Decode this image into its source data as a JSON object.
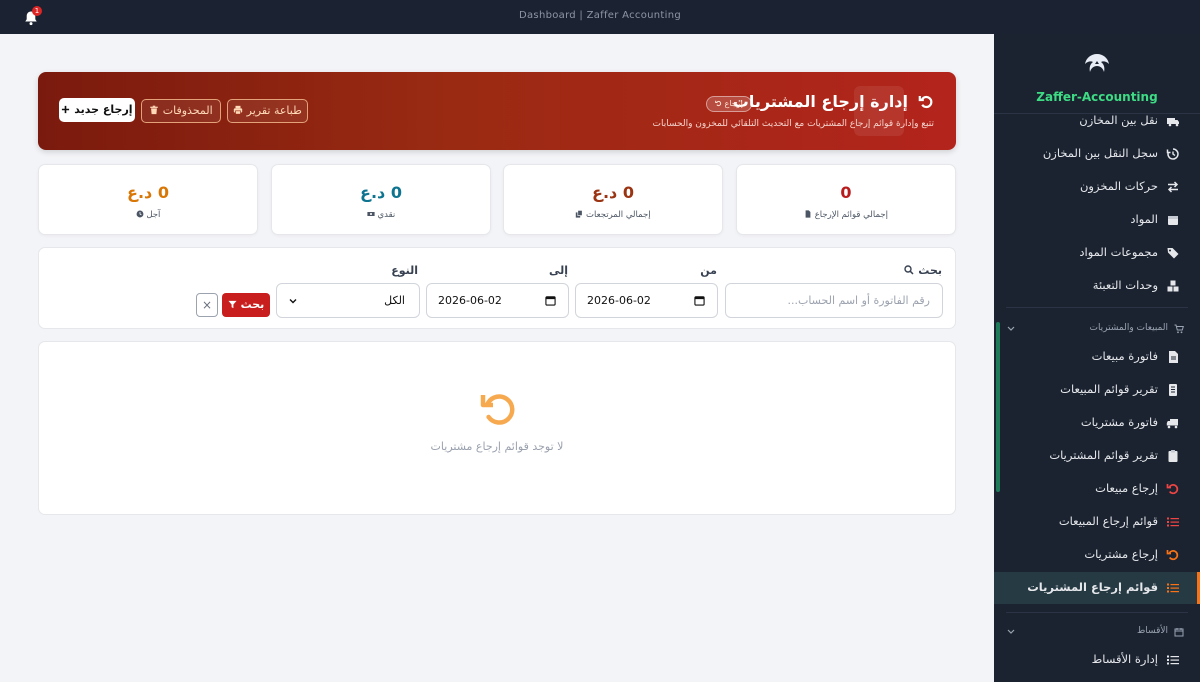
{
  "topbar": {
    "title": "Dashboard | Zaffer Accounting",
    "notification_count": "1"
  },
  "sidebar": {
    "brand": "Zaffer-Accounting",
    "items_top": [
      {
        "label": "نقل بين المخازن",
        "icon": "truck-icon"
      },
      {
        "label": "سجل النقل بين المخازن",
        "icon": "history-icon"
      },
      {
        "label": "حركات المخزون",
        "icon": "exchange-icon"
      },
      {
        "label": "المواد",
        "icon": "box-icon"
      },
      {
        "label": "مجموعات المواد",
        "icon": "tags-icon"
      },
      {
        "label": "وحدات التعبئة",
        "icon": "cubes-icon"
      }
    ],
    "section_sales": "المبيعات والمشتريات",
    "items_sales": [
      {
        "label": "فاتورة مبيعات",
        "icon": "invoice-icon"
      },
      {
        "label": "تقرير قوائم المبيعات",
        "icon": "report-icon"
      },
      {
        "label": "فاتورة مشتريات",
        "icon": "truck-icon"
      },
      {
        "label": "تقرير قوائم المشتريات",
        "icon": "clipboard-icon"
      },
      {
        "label": "إرجاع مبيعات",
        "icon": "undo-icon"
      },
      {
        "label": "قوائم إرجاع المبيعات",
        "icon": "list-icon"
      },
      {
        "label": "إرجاع مشتريات",
        "icon": "undo-icon"
      },
      {
        "label": "قوائم إرجاع المشتريات",
        "icon": "list-icon"
      }
    ],
    "section_installments": "الأقساط",
    "items_installments": [
      {
        "label": "إدارة الأقساط",
        "icon": "list-icon"
      }
    ]
  },
  "header": {
    "title": "إدارة إرجاع المشتريات",
    "badge": "إرجاع",
    "subtitle": "تتبع وإدارة قوائم إرجاع المشتريات مع التحديث التلقائي للمخزون والحسابات",
    "print_label": "طباعة تقرير",
    "deleted_label": "المحذوفات",
    "new_label": "إرجاع جديد"
  },
  "stats": [
    {
      "value": "0",
      "label": "إجمالي قوائم الإرجاع",
      "color": "#b91c1c",
      "icon": "file-icon"
    },
    {
      "value": "0 د.ع",
      "label": "إجمالي المرتجعات",
      "color": "#9a3412",
      "icon": "copy-icon"
    },
    {
      "value": "0 د.ع",
      "label": "نقدي",
      "color": "#0e7490",
      "icon": "cash-icon"
    },
    {
      "value": "0 د.ع",
      "label": "آجل",
      "color": "#d97706",
      "icon": "clock-icon"
    }
  ],
  "filter": {
    "search_label": "بحث",
    "search_placeholder": "رقم الفاتورة أو اسم الحساب...",
    "from_label": "من",
    "from_value": "2026-06-02",
    "to_label": "إلى",
    "to_value": "2026-06-02",
    "type_label": "النوع",
    "type_value": "الكل",
    "search_button": "بحث",
    "clear_button": "×"
  },
  "empty": {
    "message": "لا توجد قوائم إرجاع مشتريات"
  },
  "colors": {
    "accent": "#f97316",
    "brand_green": "#3ddc84",
    "danger": "#c81e1e"
  }
}
